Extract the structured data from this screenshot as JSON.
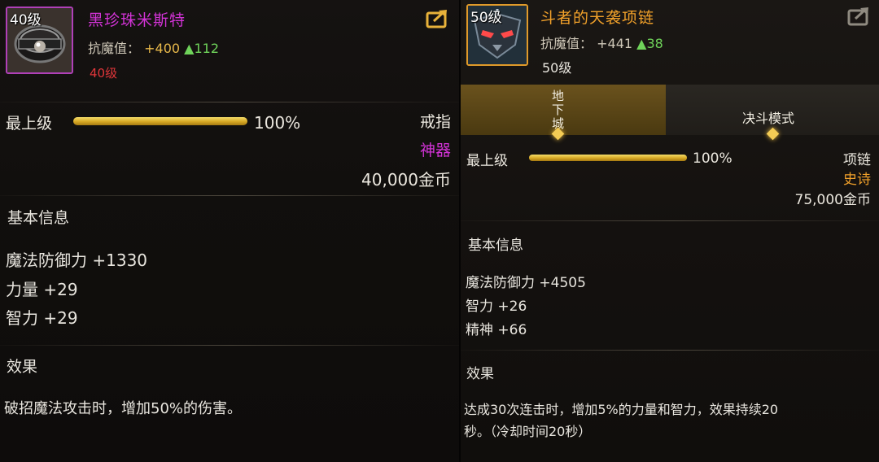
{
  "left_card": {
    "icon_level": "40级",
    "name": "黑珍珠米斯特",
    "resist_label": "抗魔值：",
    "resist_value": "+400",
    "resist_delta": "▲112",
    "level_requirement": "40级",
    "quality_label": "最上级",
    "quality_percent": 100,
    "quality_percent_text": "100%",
    "slot_type": "戒指",
    "rarity": "神器",
    "price": "40,000金币",
    "basic_info_title": "基本信息",
    "stats": [
      "魔法防御力 +1330",
      "力量 +29",
      "智力 +29"
    ],
    "effect_title": "效果",
    "effect_text": "破招魔法攻击时，增加50%的伤害。",
    "colors": {
      "name": "#d233d6",
      "rarity": "#d233d6",
      "level_req": "#e0363a"
    }
  },
  "right_card": {
    "icon_level": "50级",
    "name": "斗者的天袭项链",
    "resist_label": "抗魔值：",
    "resist_value": "+441",
    "resist_delta": "▲38",
    "level_requirement": "50级",
    "tabs": [
      {
        "label": "地下城",
        "active": true
      },
      {
        "label": "决斗模式",
        "active": false
      }
    ],
    "quality_label": "最上级",
    "quality_percent": 100,
    "quality_percent_text": "100%",
    "slot_type": "项链",
    "rarity": "史诗",
    "price": "75,000金币",
    "basic_info_title": "基本信息",
    "stats": [
      "魔法防御力 +4505",
      "智力 +26",
      "精神 +66"
    ],
    "effect_title": "效果",
    "effect_text_line1": "达成30次连击时，增加5%的力量和智力，效果持续20",
    "effect_text_line2": "秒。（冷却时间20秒）",
    "colors": {
      "name": "#f0a02a",
      "rarity": "#f0a02a",
      "level_req": "#e9e6df"
    }
  },
  "icons": [
    "ring-icon",
    "necklace-mask-icon",
    "share-icon"
  ]
}
